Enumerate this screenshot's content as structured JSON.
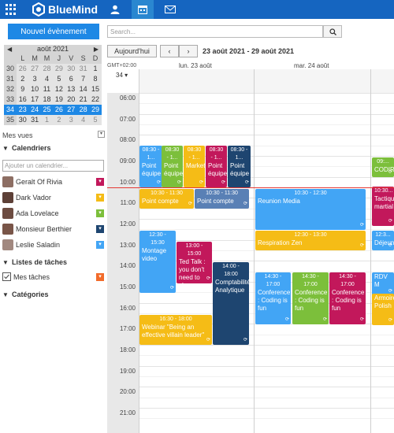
{
  "app": {
    "name": "BlueMind"
  },
  "colors": {
    "topbar": "#1565c0",
    "accent": "#1e88e5",
    "now_line": "#e53935"
  },
  "icons": {
    "apps": "grid-icon",
    "logo": "bluemind-logo-icon",
    "contacts": "user-icon",
    "calendar": "calendar-icon",
    "mail": "mail-icon"
  },
  "sidebar": {
    "new_event_label": "Nouvel évènement",
    "minical": {
      "month_label": "août 2021",
      "day_headers": [
        "L",
        "M",
        "M",
        "J",
        "V",
        "S",
        "D"
      ],
      "weeks": [
        {
          "num": "30",
          "days": [
            "26",
            "27",
            "28",
            "29",
            "30",
            "31",
            "1"
          ]
        },
        {
          "num": "31",
          "days": [
            "2",
            "3",
            "4",
            "5",
            "6",
            "7",
            "8"
          ]
        },
        {
          "num": "32",
          "days": [
            "9",
            "10",
            "11",
            "12",
            "13",
            "14",
            "15"
          ]
        },
        {
          "num": "33",
          "days": [
            "16",
            "17",
            "18",
            "19",
            "20",
            "21",
            "22"
          ]
        },
        {
          "num": "34",
          "days": [
            "23",
            "24",
            "25",
            "26",
            "27",
            "28",
            "29"
          ]
        },
        {
          "num": "35",
          "days": [
            "30",
            "31",
            "1",
            "2",
            "3",
            "4",
            "5"
          ]
        }
      ],
      "selected_week": "34"
    },
    "mes_vues_label": "Mes vues",
    "calendars_title": "Calendriers",
    "add_calendar_placeholder": "Ajouter un calendrier...",
    "calendars": [
      {
        "name": "Geralt Of Rivia",
        "color": "#c2185b"
      },
      {
        "name": "Dark Vador",
        "color": "#f5bc16"
      },
      {
        "name": "Ada Lovelace",
        "color": "#7cbf3b"
      },
      {
        "name": "Monsieur Berthier",
        "color": "#1e4570"
      },
      {
        "name": "Leslie Saladin",
        "color": "#42a5f5"
      }
    ],
    "tasks_title": "Listes de tâches",
    "tasks": [
      {
        "name": "Mes tâches",
        "color": "#f26b2a"
      }
    ],
    "categories_title": "Catégories"
  },
  "toolbar": {
    "search_placeholder": "Search...",
    "today_label": "Aujourd'hui",
    "prev_label": "‹",
    "next_label": "›",
    "date_range": "23 août 2021 - 29 août 2021"
  },
  "grid": {
    "timezone_label": "GMT+02:00",
    "week_number": "34",
    "days": [
      "lun. 23 août",
      "mar. 24 août"
    ],
    "hours": [
      "06:00",
      "07:00",
      "08:00",
      "09:00",
      "10:00",
      "11:00",
      "12:00",
      "13:00",
      "14:00",
      "15:00",
      "16:00",
      "17:00",
      "18:00",
      "19:00",
      "20:00",
      "21:00"
    ]
  },
  "events": [
    {
      "time": "08:30 - 1...",
      "title": "Point équipe",
      "color": "blue"
    },
    {
      "time": "08:30 - 1...",
      "title": "Point équipe",
      "color": "green"
    },
    {
      "time": "08:30 - 1...",
      "title": "Marketing",
      "color": "yellow"
    },
    {
      "time": "08:30 - 1...",
      "title": "Point équipe",
      "color": "red"
    },
    {
      "time": "08:30 - 1...",
      "title": "Point équipe",
      "color": "navy"
    },
    {
      "time": "10:30 - 11:30",
      "title": "Point compte",
      "color": "yellow"
    },
    {
      "time": "10:30 - 11:30",
      "title": "Point compte",
      "color": "slate"
    },
    {
      "time": "10:30 - 12:30",
      "title": "Reunion Media",
      "color": "blue"
    },
    {
      "time": "12:30 - 13:30",
      "title": "Respiration Zen",
      "color": "yellow"
    },
    {
      "time": "12:30 - 15:30",
      "title": "Montage video",
      "color": "blue"
    },
    {
      "time": "13:00 - 15:00",
      "title": "Ted Talk : you don't need to choose",
      "color": "red"
    },
    {
      "time": "14:00 - 18:00",
      "title": "Comptabilité Analytique",
      "color": "navy"
    },
    {
      "time": "14:30 - 17:00",
      "title": "Conference : Coding is fun",
      "color": "blue"
    },
    {
      "time": "14:30 - 17:00",
      "title": "Conference : Coding is fun",
      "color": "green"
    },
    {
      "time": "14:30 - 17:00",
      "title": "Conference : Coding is fun",
      "color": "red"
    },
    {
      "time": "16:30 - 18:00",
      "title": "Webinar \"Being an effective villain leader\"",
      "color": "yellow"
    },
    {
      "time": "09:...",
      "title": "CODIR",
      "color": "green"
    },
    {
      "time": "10:30...",
      "title": "Tactique martial",
      "color": "red"
    },
    {
      "time": "12:3...",
      "title": "Déjeuner",
      "color": "blue"
    },
    {
      "time": "",
      "title": "RDV M",
      "color": "blue"
    },
    {
      "time": "",
      "title": "Armoire Polish",
      "color": "yellow"
    }
  ]
}
